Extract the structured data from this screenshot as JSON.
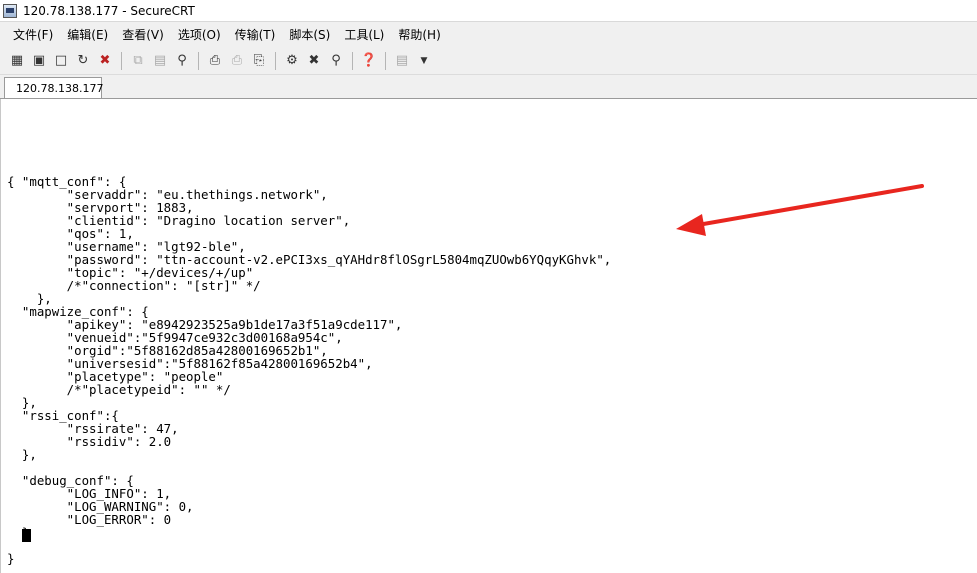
{
  "window": {
    "title": "120.78.138.177 - SecureCRT"
  },
  "menu": [
    "文件(F)",
    "编辑(E)",
    "查看(V)",
    "选项(O)",
    "传输(T)",
    "脚本(S)",
    "工具(L)",
    "帮助(H)"
  ],
  "toolbar": {
    "icons": [
      "connect-icon",
      "quick-connect-icon",
      "connect-in-tab-icon",
      "reconnect-icon",
      "disconnect-icon",
      "copy-icon",
      "paste-icon",
      "find-icon",
      "print-icon",
      "print-selection-icon",
      "print-setup-icon",
      "session-options-icon",
      "global-options-icon",
      "keymap-icon",
      "help-icon",
      "customize-toolbar-icon"
    ]
  },
  "tab": {
    "label": "120.78.138.177"
  },
  "terminal": {
    "lines": [
      "{ \"mqtt_conf\": {",
      "        \"servaddr\": \"eu.thethings.network\",",
      "        \"servport\": 1883,",
      "        \"clientid\": \"Dragino location server\",",
      "        \"qos\": 1,",
      "        \"username\": \"lgt92-ble\",",
      "        \"password\": \"ttn-account-v2.ePCI3xs_qYAHdr8flOSgrL5804mqZUOwb6YQqyKGhvk\",",
      "        \"topic\": \"+/devices/+/up\"",
      "        /*\"connection\": \"[str]\" */",
      "    },",
      "  \"mapwize_conf\": {",
      "        \"apikey\": \"e8942923525a9b1de17a3f51a9cde117\",",
      "        \"venueid\":\"5f9947ce932c3d00168a954c\",",
      "        \"orgid\":\"5f88162d85a42800169652b1\",",
      "        \"universesid\":\"5f88162f85a42800169652b4\",",
      "        \"placetype\": \"people\"",
      "        /*\"placetypeid\": \"\" */",
      "  },",
      "  \"rssi_conf\":{",
      "        \"rssirate\": 47,",
      "        \"rssidiv\": 2.0",
      "  },",
      "",
      "  \"debug_conf\": {",
      "        \"LOG_INFO\": 1,",
      "        \"LOG_WARNING\": 0,",
      "        \"LOG_ERROR\": 0",
      "  }",
      "",
      "}"
    ]
  },
  "colors": {
    "arrow": "#e8261f",
    "tab_status": "#1e9e1e",
    "terminal_bg": "#ffffff"
  }
}
